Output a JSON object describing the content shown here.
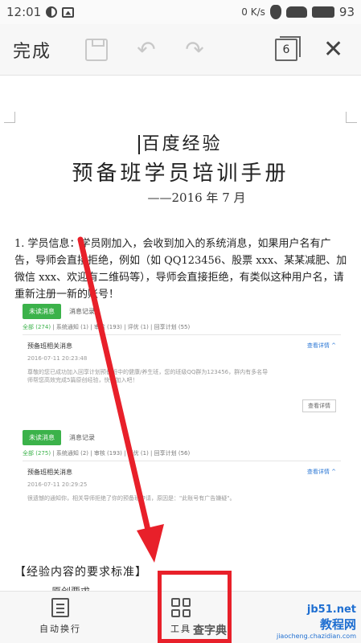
{
  "status_bar": {
    "time": "12:01",
    "net_speed": "0 K/s",
    "battery": "93"
  },
  "toolbar": {
    "done_label": "完成",
    "pages_count": "6"
  },
  "document": {
    "title_line1": "百度经验",
    "title_line2": "预备班学员培训手册",
    "date_line": "——2016 年 7 月",
    "paragraph": "1. 学员信息：学员刚加入，会收到加入的系统消息，如果用户名有广告，导师会直接拒绝，例如（如 QQ123456、股票 xxx、某某减肥、加微信 xxx、欢迎有二维码等），导师会直接拒绝，有类似这种用户名，请重新注册一新的账号！",
    "heading": "【经验内容的要求标准】",
    "sub_heading": "一、原创要求"
  },
  "screenshot_1": {
    "tab_unread": "未读消息",
    "tab_history": "消息记录",
    "filter_all": "全部 (274)",
    "filters_rest": "| 系统通知 (1) | 审核 (193) | 评优 (1) | 回享计划 (55)",
    "card_title": "预备班相关消息",
    "card_detail": "查看详情 ^",
    "card_date": "2016-07-11 20:23:48",
    "card_body": "尊敬的您已成功加入回享计划预备班中的健康/养生班，您的班级QQ群为123456，群内有多名导师帮您高效完成5篇原创经验，快去加入吧！",
    "card_button": "查看详情"
  },
  "screenshot_2": {
    "tab_unread": "未读消息",
    "tab_history": "消息记录",
    "filter_all": "全部 (275)",
    "filters_rest": "| 系统通知 (2) | 审核 (193) | 评优 (1) | 回享计划 (56)",
    "card_title": "预备班相关消息",
    "card_detail": "查看详情 ^",
    "card_date": "2016-07-11 20:29:25",
    "card_body": "很遗憾的通知你，相关导师拒绝了你的预备班申请，原因是：\"此账号有广告嫌疑\"。"
  },
  "bottom_bar": {
    "wrap_label": "自动换行",
    "tools_label": "工具"
  },
  "watermark": {
    "left": "查字典",
    "top": "jb51.net",
    "mid": "教程网",
    "url": "jiaocheng.chazidian.com"
  },
  "colors": {
    "accent_green": "#3bb24a",
    "annotation_red": "#e8202a",
    "watermark_blue": "#1f6fd1"
  }
}
